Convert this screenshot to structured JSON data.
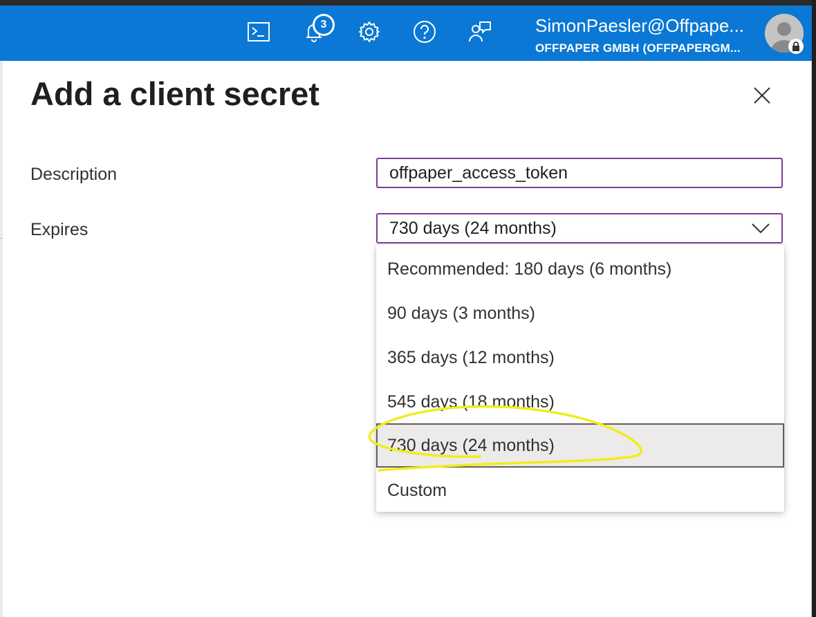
{
  "header": {
    "notification_count": "3",
    "account_name": "SimonPaesler@Offpape...",
    "account_org": "OFFPAPER GMBH (OFFPAPERGM...",
    "icons": [
      "cloud-shell-icon",
      "bell-icon",
      "gear-icon",
      "help-icon",
      "feedback-icon",
      "avatar-icon",
      "lock-icon"
    ]
  },
  "panel": {
    "title": "Add a client secret",
    "description_label": "Description",
    "description_value": "offpaper_access_token",
    "expires_label": "Expires",
    "expires_value": "730 days (24 months)"
  },
  "dropdown": {
    "options": [
      "Recommended: 180 days (6 months)",
      "90 days (3 months)",
      "365 days (12 months)",
      "545 days (18 months)",
      "730 days (24 months)",
      "Custom"
    ],
    "selected_index": 4
  },
  "colors": {
    "topbar": "#0a78d4",
    "input_border": "#7d3c98",
    "annotation": "#f2ec1c"
  }
}
